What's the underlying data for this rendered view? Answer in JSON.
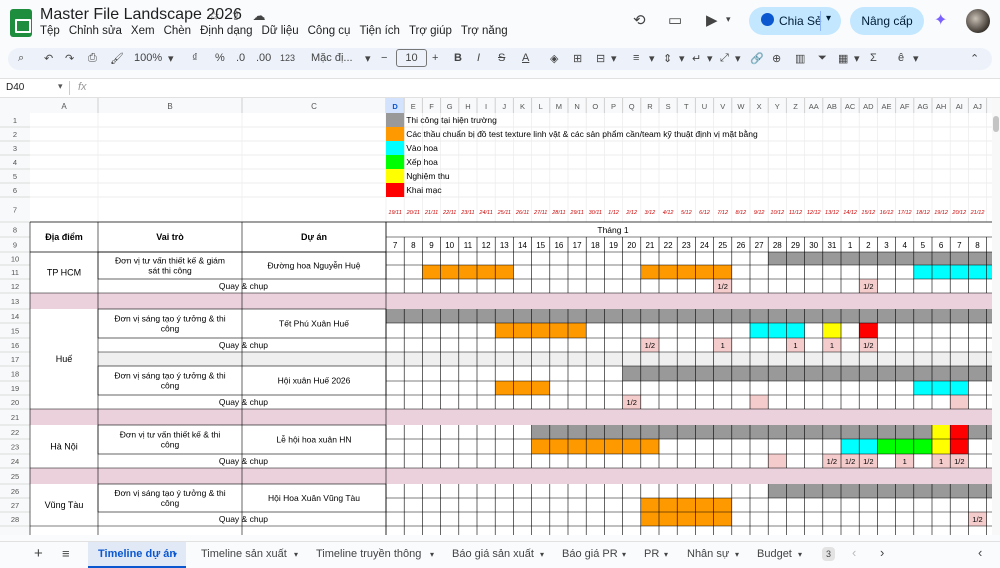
{
  "app": {
    "title": "Master File Landscape 2026",
    "menus": [
      "Tệp",
      "Chỉnh sửa",
      "Xem",
      "Chèn",
      "Định dạng",
      "Dữ liệu",
      "Công cụ",
      "Tiện ích",
      "Trợ giúp",
      "Trợ năng"
    ],
    "share_label": "Chia Sẻ",
    "upgrade_label": "Nâng cấp"
  },
  "toolbar": {
    "zoom": "100%",
    "percent": "%",
    "decimal_dec": ".0",
    "decimal_inc": ".00",
    "number_format": "123",
    "font": "Mặc đị...",
    "font_size": "10",
    "bold": "B",
    "italic": "I",
    "strike": "S",
    "text_color": "A",
    "sum": "Σ"
  },
  "formula_bar": {
    "cell_ref": "D40",
    "fx": "fx"
  },
  "columns": [
    "A",
    "B",
    "C",
    "D",
    "E",
    "F",
    "G",
    "H",
    "I",
    "J",
    "K",
    "L",
    "M",
    "N",
    "O",
    "P",
    "Q",
    "R",
    "S",
    "T",
    "U",
    "V",
    "W",
    "X",
    "Y",
    "Z",
    "AA",
    "AB",
    "AC",
    "AD",
    "AE",
    "AF",
    "AG",
    "AH",
    "AI",
    "AJ"
  ],
  "row_numbers": [
    "1",
    "2",
    "3",
    "4",
    "5",
    "6",
    "7",
    "8",
    "9",
    "10",
    "11",
    "12",
    "13",
    "14",
    "15",
    "16",
    "17",
    "18",
    "19",
    "20",
    "21",
    "22",
    "23",
    "24",
    "25",
    "26",
    "27",
    "28"
  ],
  "legend": [
    {
      "color": "#999999",
      "label": "Thi công tại hiện trường"
    },
    {
      "color": "#ff9900",
      "label": "Các thầu chuẩn bị đồ test texture linh vật & các sản phẩm cần/team kỹ thuật định vị mặt bằng"
    },
    {
      "color": "#00ffff",
      "label": "Vào hoa"
    },
    {
      "color": "#00ff00",
      "label": "Xếp hoa"
    },
    {
      "color": "#ffff00",
      "label": "Nghiệm thu"
    },
    {
      "color": "#ff0000",
      "label": "Khai mạc"
    }
  ],
  "date_row": [
    "19/11",
    "20/11",
    "21/11",
    "22/11",
    "23/11",
    "24/11",
    "25/11",
    "26/11",
    "27/11",
    "28/11",
    "29/11",
    "30/11",
    "1/12",
    "2/12",
    "3/12",
    "4/12",
    "5/12",
    "6/12",
    "7/12",
    "8/12",
    "9/12",
    "10/12",
    "11/12",
    "12/12",
    "13/12",
    "14/12",
    "15/12",
    "16/12",
    "17/12",
    "18/12",
    "19/12",
    "20/12",
    "21/12"
  ],
  "header": {
    "location": "Địa điểm",
    "role": "Vai trò",
    "project": "Dự án",
    "month": "Tháng 1"
  },
  "days": [
    "7",
    "8",
    "9",
    "10",
    "11",
    "12",
    "13",
    "14",
    "15",
    "16",
    "17",
    "18",
    "19",
    "20",
    "21",
    "22",
    "23",
    "24",
    "25",
    "26",
    "27",
    "28",
    "29",
    "30",
    "31",
    "1",
    "2",
    "3",
    "4",
    "5",
    "6",
    "7",
    "8",
    ""
  ],
  "sections": [
    {
      "location": "TP HCM",
      "role": "Đơn vị tư vấn thiết kế & giám sát thi công",
      "project": "Đường hoa Nguyễn Huệ",
      "shoot": "Quay & chụp"
    },
    {
      "location": "Huế",
      "role": "Đơn vị sáng tạo ý tưởng & thi công",
      "project": "Tết Phú Xuân Huế",
      "shoot": "Quay & chụp"
    },
    {
      "location": "",
      "role": "Đơn vị sáng tạo ý tưởng & thi công",
      "project": "Hội xuân Huế 2026",
      "shoot": "Quay & chụp"
    },
    {
      "location": "Hà Nội",
      "role": "Đơn vị tư vấn thiết kế & thi công",
      "project": "Lễ hội hoa xuân HN",
      "shoot": "Quay & chụp"
    },
    {
      "location": "Vũng Tàu",
      "role": "Đơn vị sáng tạo ý tưởng & thi công",
      "project": "Hội Hoa Xuân Vũng Tàu",
      "shoot": "Quay & chụp"
    }
  ],
  "marks": {
    "half": "1/2",
    "one": "1"
  },
  "colors": {
    "gray": "#999999",
    "orange": "#ff9900",
    "cyan": "#00ffff",
    "green": "#00ff00",
    "yellow": "#ffff00",
    "red": "#ff0000",
    "pink": "#ead1dc",
    "shoot_pink": "#f4cccc",
    "date_red": "#cc0000"
  },
  "sheet_tabs": [
    "Timeline dự án",
    "Timeline sản xuất",
    "Timeline truyền thông",
    "Báo giá sản xuất",
    "Báo giá PR",
    "PR",
    "Nhân sự",
    "Budget",
    "3"
  ]
}
